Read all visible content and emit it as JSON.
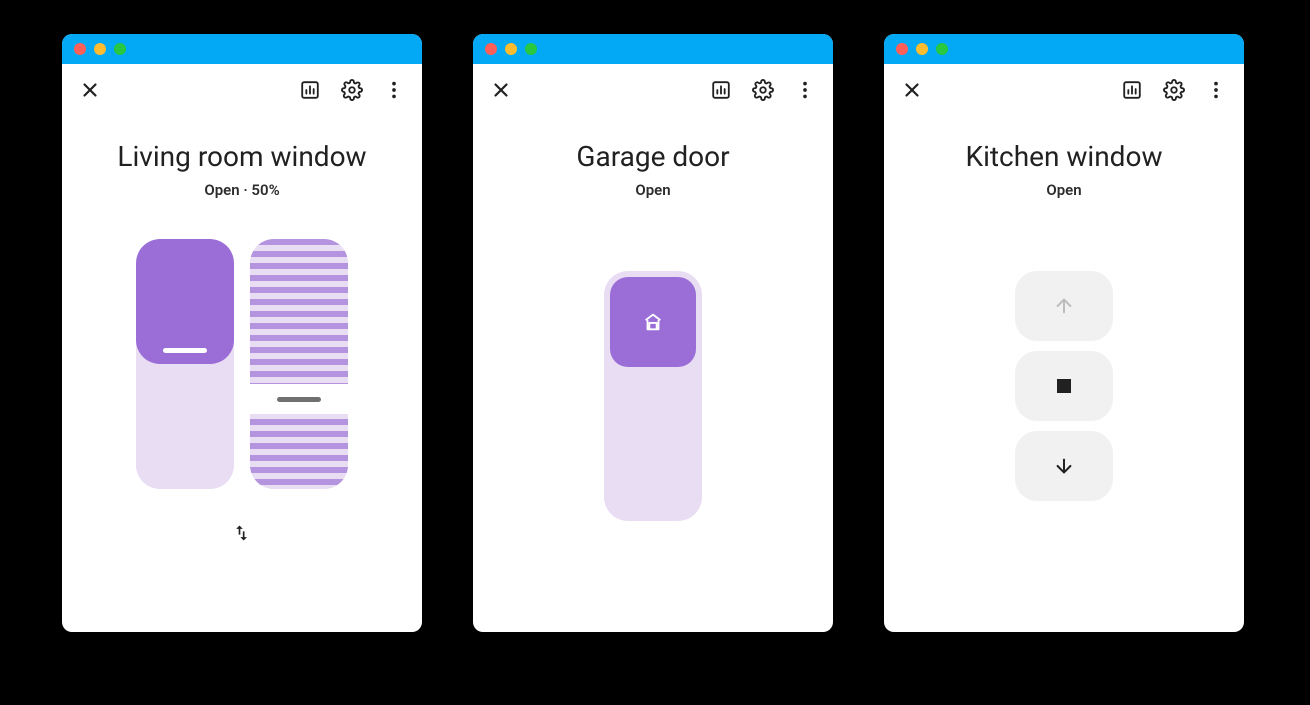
{
  "panels": [
    {
      "title": "Living room window",
      "subtitle": "Open · 50%",
      "cover_percent": 50,
      "tilt_percent_from_top": 64
    },
    {
      "title": "Garage door",
      "subtitle": "Open"
    },
    {
      "title": "Kitchen window",
      "subtitle": "Open",
      "buttons": {
        "up_enabled": false,
        "stop_enabled": true,
        "down_enabled": true
      }
    }
  ],
  "icons": {
    "close": "close-icon",
    "chart": "chart-icon",
    "settings": "gear-icon",
    "more": "more-vert-icon",
    "swap": "swap-vert-icon",
    "garage": "garage-icon",
    "arrow_up": "arrow-up-icon",
    "arrow_down": "arrow-down-icon",
    "stop": "stop-icon"
  }
}
